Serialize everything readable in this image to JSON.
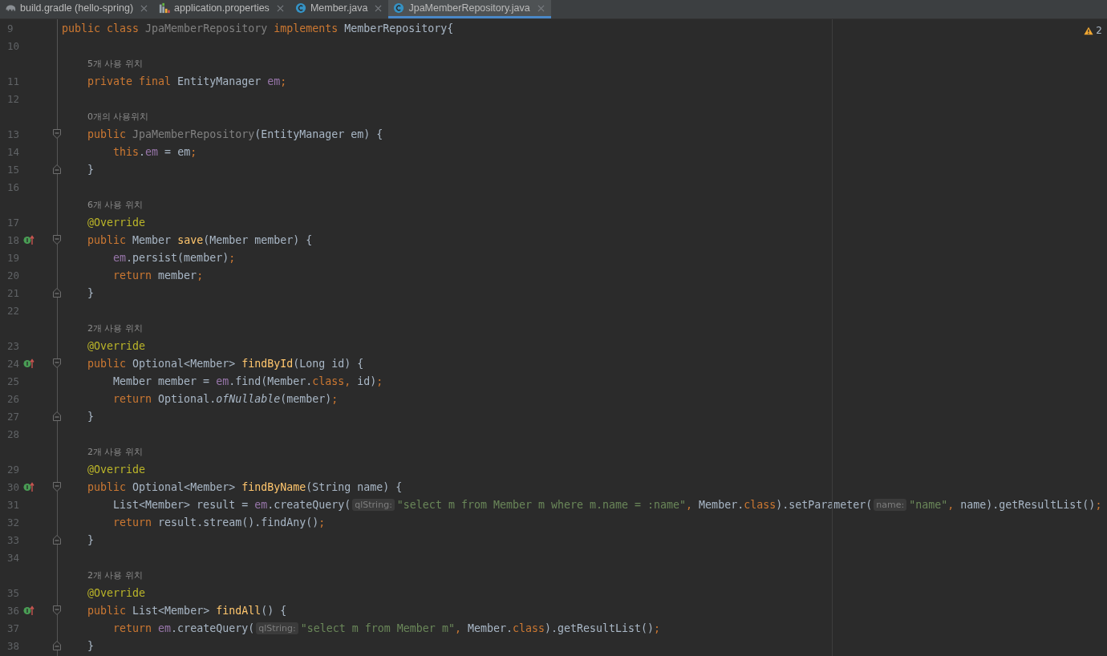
{
  "tabs": [
    {
      "label": "build.gradle (hello-spring)",
      "kind": "gradle",
      "selected": false
    },
    {
      "label": "application.properties",
      "kind": "properties",
      "selected": false
    },
    {
      "label": "Member.java",
      "kind": "class",
      "selected": false
    },
    {
      "label": "JpaMemberRepository.java",
      "kind": "class",
      "selected": true
    }
  ],
  "inspections": {
    "warnings": "2"
  },
  "rows": [
    {
      "kind": "code",
      "number": "9",
      "tokens": [
        {
          "kind": "keyword",
          "text": "public class "
        },
        {
          "kind": "unused",
          "text": "JpaMemberRepository"
        },
        {
          "kind": "keyword",
          "text": " implements "
        },
        {
          "kind": "plain",
          "text": "MemberRepository{"
        }
      ]
    },
    {
      "kind": "code",
      "number": "10"
    },
    {
      "kind": "usages",
      "text": "5개 사용 위치"
    },
    {
      "kind": "code",
      "number": "11",
      "tokens": [
        {
          "kind": "keyword",
          "text": "    private final "
        },
        {
          "kind": "plain",
          "text": "EntityManager "
        },
        {
          "kind": "field",
          "text": "em"
        },
        {
          "kind": "keyword",
          "text": ";"
        }
      ]
    },
    {
      "kind": "code",
      "number": "12"
    },
    {
      "kind": "usages",
      "text": "0개의 사용위치"
    },
    {
      "kind": "code",
      "number": "13",
      "gutter_icons": [
        {
          "kind": "fold-start"
        }
      ],
      "tokens": [
        {
          "kind": "keyword",
          "text": "    public "
        },
        {
          "kind": "unused",
          "text": "JpaMemberRepository"
        },
        {
          "kind": "plain",
          "text": "(EntityManager em) {"
        }
      ]
    },
    {
      "kind": "code",
      "number": "14",
      "tokens": [
        {
          "kind": "keyword",
          "text": "        this"
        },
        {
          "kind": "plain",
          "text": "."
        },
        {
          "kind": "field",
          "text": "em"
        },
        {
          "kind": "plain",
          "text": " = em"
        },
        {
          "kind": "keyword",
          "text": ";"
        }
      ]
    },
    {
      "kind": "code",
      "number": "15",
      "gutter_icons": [
        {
          "kind": "fold-end"
        }
      ],
      "tokens": [
        {
          "kind": "plain",
          "text": "    }"
        }
      ]
    },
    {
      "kind": "code",
      "number": "16"
    },
    {
      "kind": "usages",
      "text": "6개 사용 위치"
    },
    {
      "kind": "code",
      "number": "17",
      "tokens": [
        {
          "kind": "annotation",
          "text": "    @Override"
        }
      ]
    },
    {
      "kind": "code",
      "number": "18",
      "gutter_icons": [
        {
          "kind": "implements"
        },
        {
          "kind": "fold-start"
        }
      ],
      "tokens": [
        {
          "kind": "keyword",
          "text": "    public "
        },
        {
          "kind": "plain",
          "text": "Member "
        },
        {
          "kind": "declaration",
          "text": "save"
        },
        {
          "kind": "plain",
          "text": "(Member member) {"
        }
      ]
    },
    {
      "kind": "code",
      "number": "19",
      "tokens": [
        {
          "kind": "field",
          "text": "        em"
        },
        {
          "kind": "plain",
          "text": ".persist(member)"
        },
        {
          "kind": "keyword",
          "text": ";"
        }
      ]
    },
    {
      "kind": "code",
      "number": "20",
      "tokens": [
        {
          "kind": "keyword",
          "text": "        return "
        },
        {
          "kind": "plain",
          "text": "member"
        },
        {
          "kind": "keyword",
          "text": ";"
        }
      ]
    },
    {
      "kind": "code",
      "number": "21",
      "gutter_icons": [
        {
          "kind": "fold-end"
        }
      ],
      "tokens": [
        {
          "kind": "plain",
          "text": "    }"
        }
      ]
    },
    {
      "kind": "code",
      "number": "22"
    },
    {
      "kind": "usages",
      "text": "2개 사용 위치"
    },
    {
      "kind": "code",
      "number": "23",
      "tokens": [
        {
          "kind": "annotation",
          "text": "    @Override"
        }
      ]
    },
    {
      "kind": "code",
      "number": "24",
      "gutter_icons": [
        {
          "kind": "implements"
        },
        {
          "kind": "fold-start"
        }
      ],
      "tokens": [
        {
          "kind": "keyword",
          "text": "    public "
        },
        {
          "kind": "plain",
          "text": "Optional<Member> "
        },
        {
          "kind": "declaration",
          "text": "findById"
        },
        {
          "kind": "plain",
          "text": "(Long id) {"
        }
      ]
    },
    {
      "kind": "code",
      "number": "25",
      "tokens": [
        {
          "kind": "plain",
          "text": "        Member member = "
        },
        {
          "kind": "field",
          "text": "em"
        },
        {
          "kind": "plain",
          "text": ".find(Member."
        },
        {
          "kind": "keyword",
          "text": "class, "
        },
        {
          "kind": "plain",
          "text": "id)"
        },
        {
          "kind": "keyword",
          "text": ";"
        }
      ]
    },
    {
      "kind": "code",
      "number": "26",
      "tokens": [
        {
          "kind": "keyword",
          "text": "        return "
        },
        {
          "kind": "plain",
          "text": "Optional."
        },
        {
          "kind": "static",
          "text": "ofNullable"
        },
        {
          "kind": "plain",
          "text": "(member)"
        },
        {
          "kind": "keyword",
          "text": ";"
        }
      ]
    },
    {
      "kind": "code",
      "number": "27",
      "gutter_icons": [
        {
          "kind": "fold-end"
        }
      ],
      "tokens": [
        {
          "kind": "plain",
          "text": "    }"
        }
      ]
    },
    {
      "kind": "code",
      "number": "28"
    },
    {
      "kind": "usages",
      "text": "2개 사용 위치"
    },
    {
      "kind": "code",
      "number": "29",
      "tokens": [
        {
          "kind": "annotation",
          "text": "    @Override"
        }
      ]
    },
    {
      "kind": "code",
      "number": "30",
      "gutter_icons": [
        {
          "kind": "implements"
        },
        {
          "kind": "fold-start"
        }
      ],
      "tokens": [
        {
          "kind": "keyword",
          "text": "    public "
        },
        {
          "kind": "plain",
          "text": "Optional<Member> "
        },
        {
          "kind": "declaration",
          "text": "findByName"
        },
        {
          "kind": "plain",
          "text": "(String name) {"
        }
      ]
    },
    {
      "kind": "code",
      "number": "31",
      "tokens": [
        {
          "kind": "plain",
          "text": "        List<Member> result = "
        },
        {
          "kind": "field",
          "text": "em"
        },
        {
          "kind": "plain",
          "text": ".createQuery("
        },
        {
          "kind": "hint",
          "text": "qlString:"
        },
        {
          "kind": "string",
          "text": "\"select m from Member m where m.name = :name\""
        },
        {
          "kind": "keyword",
          "text": ", "
        },
        {
          "kind": "plain",
          "text": "Member."
        },
        {
          "kind": "keyword",
          "text": "class"
        },
        {
          "kind": "plain",
          "text": ").setParameter("
        },
        {
          "kind": "hint",
          "text": "name:"
        },
        {
          "kind": "string",
          "text": "\"name\""
        },
        {
          "kind": "keyword",
          "text": ", "
        },
        {
          "kind": "plain",
          "text": "name).getResultList()"
        },
        {
          "kind": "keyword",
          "text": ";"
        }
      ]
    },
    {
      "kind": "code",
      "number": "32",
      "tokens": [
        {
          "kind": "keyword",
          "text": "        return "
        },
        {
          "kind": "plain",
          "text": "result.stream().findAny()"
        },
        {
          "kind": "keyword",
          "text": ";"
        }
      ]
    },
    {
      "kind": "code",
      "number": "33",
      "gutter_icons": [
        {
          "kind": "fold-end"
        }
      ],
      "tokens": [
        {
          "kind": "plain",
          "text": "    }"
        }
      ]
    },
    {
      "kind": "code",
      "number": "34"
    },
    {
      "kind": "usages",
      "text": "2개 사용 위치"
    },
    {
      "kind": "code",
      "number": "35",
      "tokens": [
        {
          "kind": "annotation",
          "text": "    @Override"
        }
      ]
    },
    {
      "kind": "code",
      "number": "36",
      "gutter_icons": [
        {
          "kind": "implements"
        },
        {
          "kind": "fold-start"
        }
      ],
      "tokens": [
        {
          "kind": "keyword",
          "text": "    public "
        },
        {
          "kind": "plain",
          "text": "List<Member> "
        },
        {
          "kind": "declaration",
          "text": "findAll"
        },
        {
          "kind": "plain",
          "text": "() {"
        }
      ]
    },
    {
      "kind": "code",
      "number": "37",
      "tokens": [
        {
          "kind": "keyword",
          "text": "        return "
        },
        {
          "kind": "field",
          "text": "em"
        },
        {
          "kind": "plain",
          "text": ".createQuery("
        },
        {
          "kind": "hint",
          "text": "qlString:"
        },
        {
          "kind": "string",
          "text": "\"select m from Member m\""
        },
        {
          "kind": "keyword",
          "text": ", "
        },
        {
          "kind": "plain",
          "text": "Member."
        },
        {
          "kind": "keyword",
          "text": "class"
        },
        {
          "kind": "plain",
          "text": ").getResultList()"
        },
        {
          "kind": "keyword",
          "text": ";"
        }
      ]
    },
    {
      "kind": "code",
      "number": "38",
      "gutter_icons": [
        {
          "kind": "fold-end"
        }
      ],
      "tokens": [
        {
          "kind": "plain",
          "text": "    }"
        }
      ]
    }
  ]
}
